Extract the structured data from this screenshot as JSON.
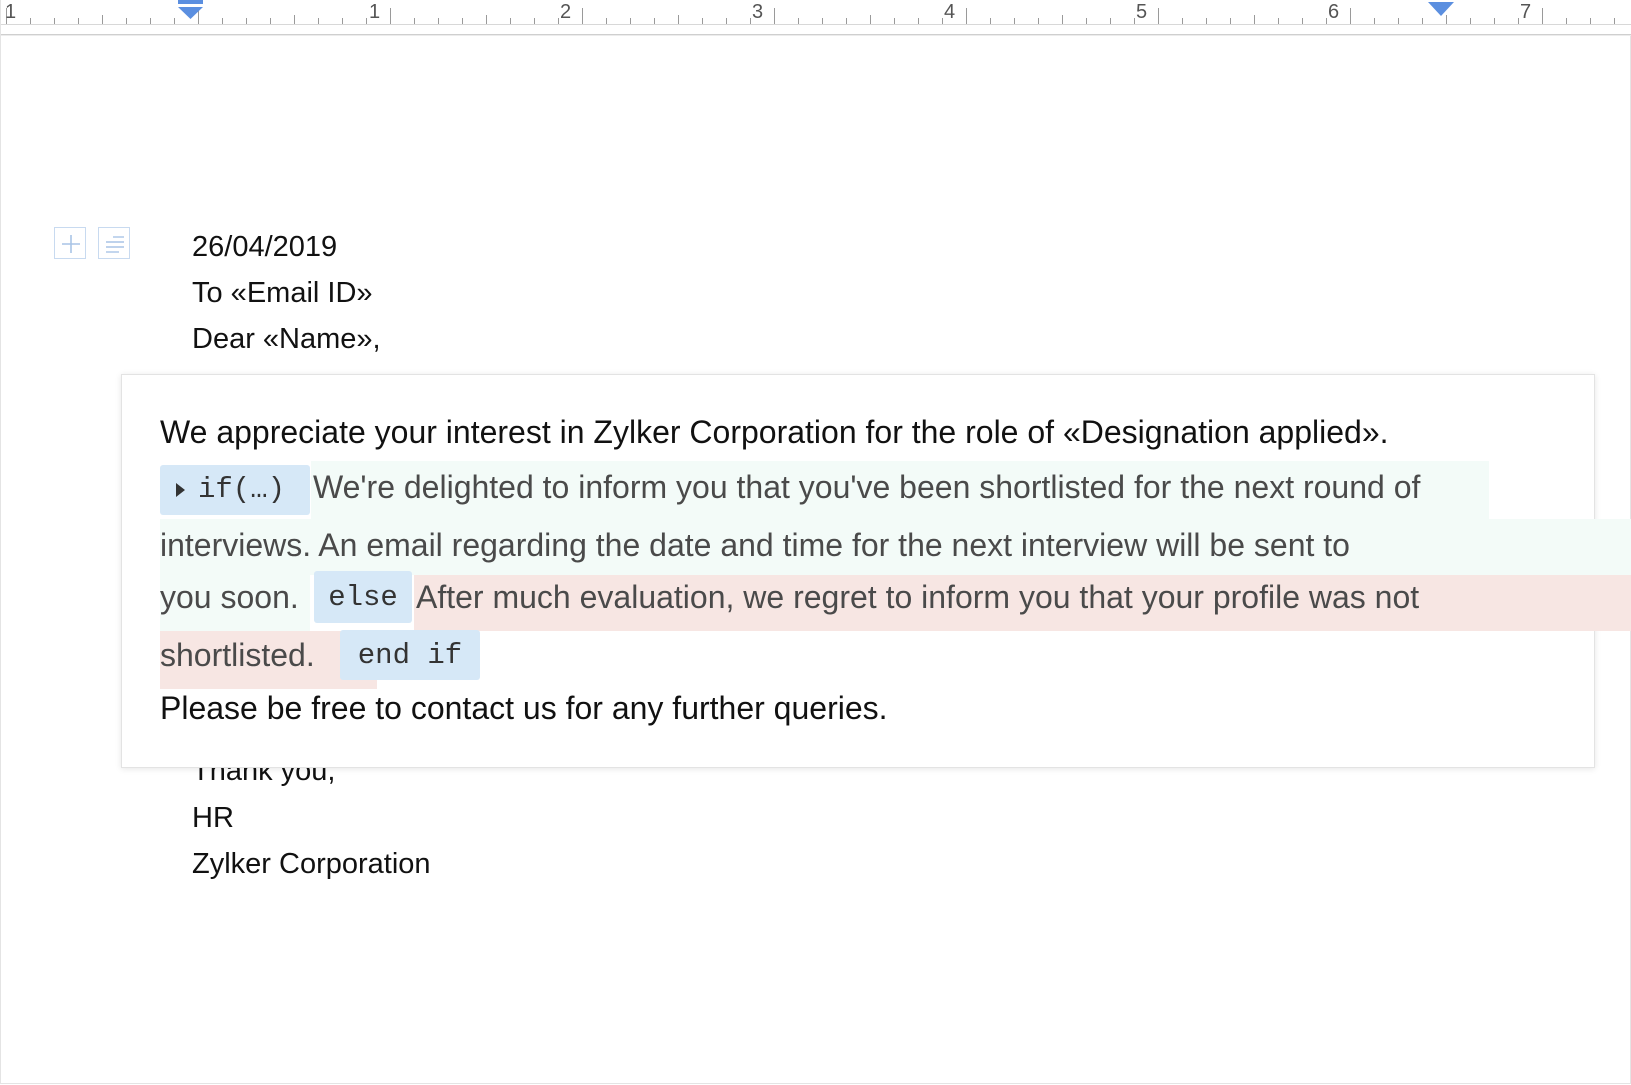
{
  "ruler": {
    "numbers": [
      "1",
      "1",
      "2",
      "3",
      "4",
      "5",
      "6",
      "7"
    ]
  },
  "gutter": {
    "add_icon": "plus-icon",
    "paragraph_icon": "paragraph-lines-icon"
  },
  "letter": {
    "date": "26/04/2019",
    "to_line": "To «Email ID»",
    "greeting": "Dear «Name»,",
    "closing_partial": "Thank you,",
    "signature_dept": "HR",
    "signature_company": "Zylker Corporation"
  },
  "conditional_block": {
    "intro": "We appreciate your interest in Zylker Corporation for the role of «Designation applied».",
    "if_chip": "if(…)",
    "if_text_line1": "We're delighted to inform you that you've been shortlisted for the next round of",
    "if_text_line2": "interviews. An email regarding the date and time for the next interview will be sent to",
    "if_text_line3": "you soon.",
    "else_chip": "else",
    "else_text_line1": "After much evaluation, we regret to inform you that your profile was not",
    "else_text_line2": "shortlisted.",
    "end_chip": "end if",
    "outro": "Please be free to contact us for any further queries."
  },
  "colors": {
    "chip_bg": "#d6e8f7",
    "if_bg": "#f3fbf8",
    "else_bg": "#f7e6e3",
    "marker_blue": "#5b8fe0"
  }
}
